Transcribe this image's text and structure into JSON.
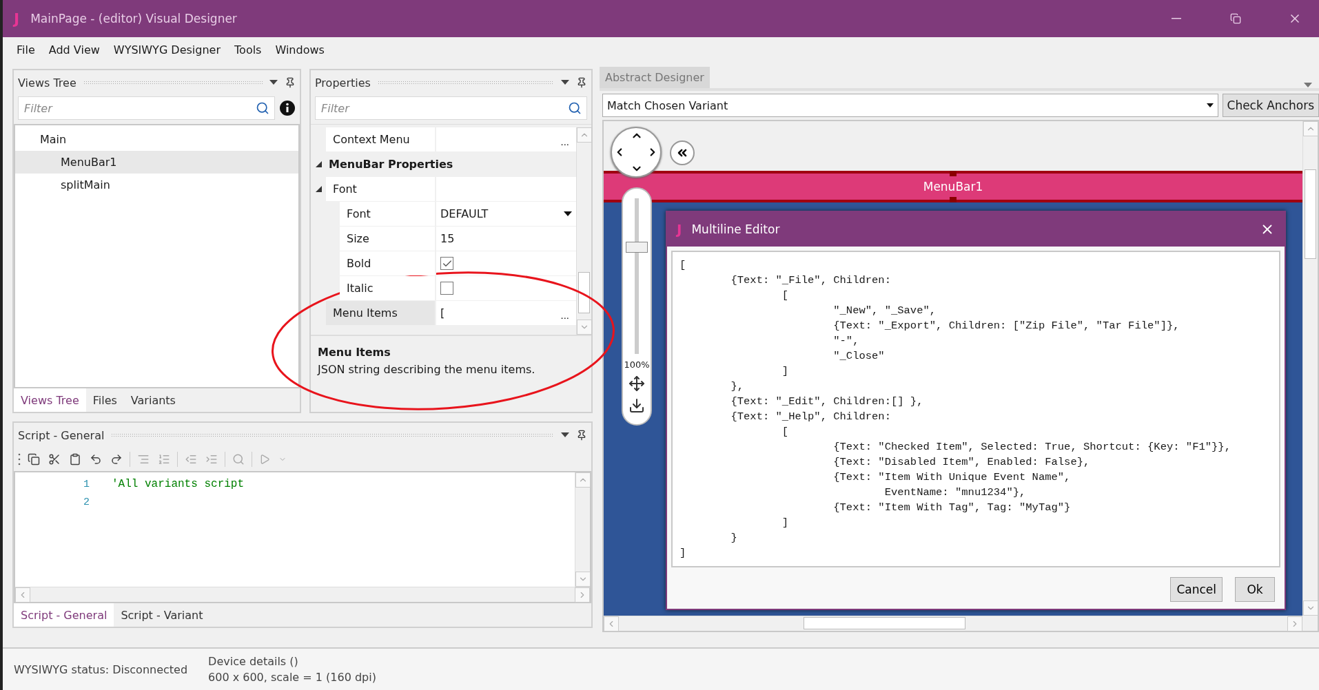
{
  "window": {
    "logo": "J",
    "title": "MainPage - (editor) Visual Designer"
  },
  "menu": [
    "File",
    "Add View",
    "WYSIWYG Designer",
    "Tools",
    "Windows"
  ],
  "views_tree": {
    "title": "Views Tree",
    "filter": {
      "placeholder": "Filter"
    },
    "items": [
      {
        "label": "Main",
        "selected": false,
        "children": [
          {
            "label": "MenuBar1",
            "selected": true
          },
          {
            "label": "splitMain",
            "selected": false
          }
        ]
      }
    ],
    "tabs": [
      {
        "label": "Views Tree",
        "selected": true
      },
      {
        "label": "Files",
        "selected": false
      },
      {
        "label": "Variants",
        "selected": false
      }
    ]
  },
  "properties": {
    "title": "Properties",
    "filter": {
      "placeholder": "Filter"
    },
    "rows": [
      {
        "kind": "dialog",
        "label": "Context Menu",
        "button": "...",
        "selected": false
      },
      {
        "kind": "category",
        "label": "MenuBar Properties",
        "expanded": true,
        "children": [
          {
            "kind": "group",
            "label": "Font",
            "expanded": true,
            "selected": false,
            "children": [
              {
                "kind": "dropdown",
                "label": "Font",
                "value": "DEFAULT",
                "selected": false
              },
              {
                "kind": "text",
                "label": "Size",
                "value": "15",
                "selected": false
              },
              {
                "kind": "checkbox",
                "label": "Bold",
                "checked": true,
                "selected": false
              },
              {
                "kind": "checkbox",
                "label": "Italic",
                "checked": false,
                "selected": false
              }
            ]
          },
          {
            "kind": "dialog",
            "label": "Menu Items",
            "value": "[",
            "button": "...",
            "selected": true
          }
        ]
      }
    ],
    "description": {
      "title": "Menu Items",
      "text": "JSON string describing the menu items."
    }
  },
  "script": {
    "title": "Script - General",
    "lines": [
      {
        "number": "1",
        "text": "'All variants script"
      },
      {
        "number": "2"
      }
    ],
    "tabs": [
      {
        "label": "Script - General",
        "selected": true
      },
      {
        "label": "Script - Variant",
        "selected": false
      }
    ]
  },
  "designer": {
    "tab": "Abstract Designer",
    "variant": {
      "value": "Match Chosen Variant"
    },
    "check_button": "Check Anchors",
    "zoom": {
      "level": 0.7,
      "reading": "100%"
    },
    "menubar": {
      "label": "MenuBar1"
    },
    "editor": {
      "logo": "J",
      "title": "Multiline Editor",
      "lines": [
        "[",
        "\t{Text: \"_File\", Children:",
        "\t\t[",
        "\t\t\t\"_New\", \"_Save\",",
        "\t\t\t{Text: \"_Export\", Children: [\"Zip File\", \"Tar File\"]},",
        "\t\t\t\"-\",",
        "\t\t\t\"_Close\"",
        "\t\t]",
        "\t},",
        "\t{Text: \"_Edit\", Children:[] },",
        "\t{Text: \"_Help\", Children:",
        "\t\t[",
        "\t\t\t{Text: \"Checked Item\", Selected: True, Shortcut: {Key: \"F1\"}},",
        "\t\t\t{Text: \"Disabled Item\", Enabled: False},",
        "\t\t\t{Text: \"Item With Unique Event Name\",",
        "\t\t\t\tEventName: \"mnu1234\"},",
        "\t\t\t{Text: \"Item With Tag\", Tag: \"MyTag\"}",
        "\t\t]",
        "\t}",
        "]"
      ],
      "buttons": [
        "Cancel",
        "Ok"
      ]
    }
  },
  "status": {
    "connection": "WYSIWYG status: Disconnected",
    "device_title": "Device details ()",
    "device_info": "600 x 600, scale = 1 (160 dpi)"
  }
}
